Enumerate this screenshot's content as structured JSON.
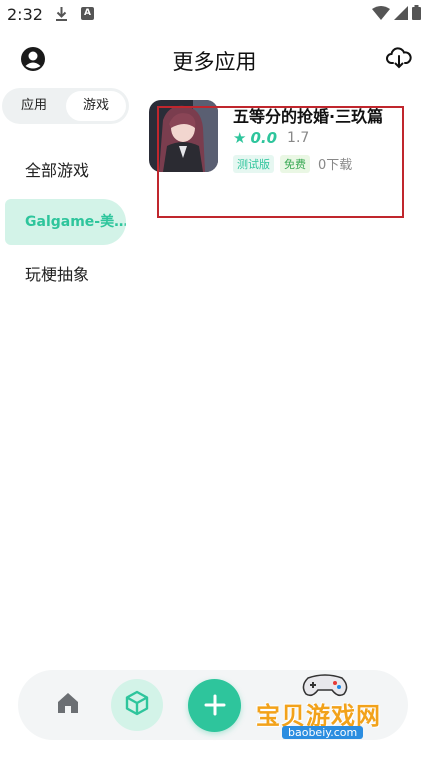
{
  "status_bar": {
    "time": "2:32"
  },
  "header": {
    "title": "更多应用"
  },
  "segment": {
    "left_label": "应用",
    "right_label": "游戏"
  },
  "sidebar": {
    "items": [
      {
        "label": "全部游戏"
      },
      {
        "label": "Galgame-美…"
      },
      {
        "label": "玩梗抽象"
      }
    ],
    "active_index": 1
  },
  "app": {
    "title": "五等分的抢婚·三玖篇",
    "rating": "0.0",
    "version": "1.7",
    "tags": [
      "测试版",
      "免费"
    ],
    "downloads": "0下载"
  },
  "watermark": {
    "text": "宝贝游戏网",
    "url": "baobeiy.com"
  },
  "colors": {
    "accent": "#2ec59c",
    "accent_light": "#d3f3e8",
    "highlight": "#c0262d"
  }
}
